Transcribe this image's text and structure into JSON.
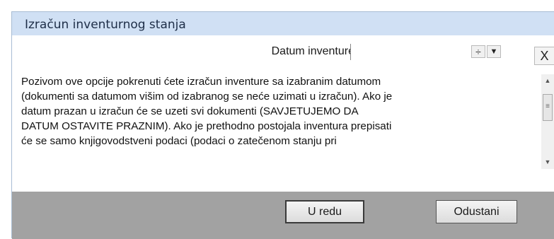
{
  "window": {
    "title": "Izračun inventurnog stanja"
  },
  "date": {
    "label": "Datum inventure",
    "value": "",
    "spin_glyph": "÷",
    "dropdown_glyph": "▼"
  },
  "close_label": "X",
  "description": "Pozivom ove opcije pokrenuti ćete izračun inventure sa izabranim datumom\n(dokumenti sa datumom višim od izabranog se neće uzimati u izračun). Ako je\ndatum prazan u izračun će se uzeti svi dokumenti (SAVJETUJEMO DA\nDATUM OSTAVITE PRAZNIM). Ako je prethodno postojala inventura prepisati\nće se samo knjigovodstveni podaci (podaci o zatečenom stanju pri",
  "scrollbar": {
    "up": "▲",
    "thumb": "≡",
    "down": "▼"
  },
  "buttons": {
    "ok": "U redu",
    "cancel": "Odustani"
  }
}
